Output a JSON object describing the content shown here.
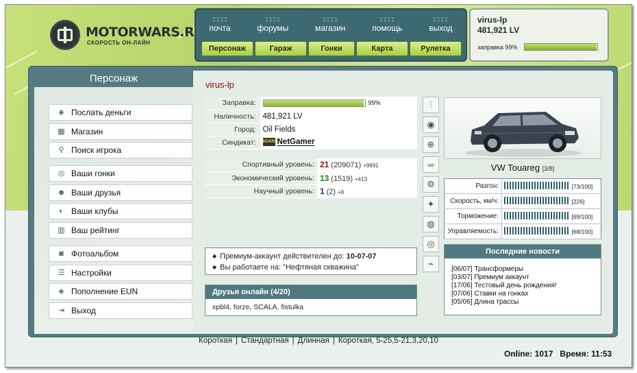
{
  "logo": {
    "title": "MOTORWARS.RU",
    "subtitle": "СКОРОСТЬ ОН-ЛАЙН"
  },
  "topnav": {
    "links": [
      "почта",
      "форумы",
      "магазин",
      "помощь",
      "выход"
    ],
    "buttons": [
      "Персонаж",
      "Гараж",
      "Гонки",
      "Карта",
      "Рулетка"
    ]
  },
  "userpanel": {
    "username": "virus-lp",
    "money": "481,921 LV",
    "fuel_label": "заправка 99%",
    "fuel_percent": 99
  },
  "sidebar": {
    "title": "Персонаж",
    "groups": [
      [
        {
          "label": "Послать деньги",
          "icon": "money-icon"
        },
        {
          "label": "Магазин",
          "icon": "shop-icon"
        },
        {
          "label": "Поиск игрока",
          "icon": "search-icon"
        }
      ],
      [
        {
          "label": "Ваши гонки",
          "icon": "steering-wheel-icon"
        },
        {
          "label": "Ваши друзья",
          "icon": "friends-icon"
        },
        {
          "label": "Ваши клубы",
          "icon": "clubs-icon"
        },
        {
          "label": "Ваш рейтинг",
          "icon": "rating-icon"
        }
      ],
      [
        {
          "label": "Фотоальбом",
          "icon": "camera-icon"
        },
        {
          "label": "Настройки",
          "icon": "settings-icon"
        },
        {
          "label": "Пополнение EUN",
          "icon": "wallet-icon"
        },
        {
          "label": "Выход",
          "icon": "exit-icon"
        }
      ]
    ]
  },
  "profile": {
    "name": "virus-lp",
    "fuel": {
      "label": "Заправка:",
      "percent": 99,
      "percent_text": "99%"
    },
    "cash": {
      "label": "Наличность:",
      "value": "481,921 LV"
    },
    "city": {
      "label": "Город:",
      "value": "Oil Fields"
    },
    "syndicate": {
      "label": "Синдикат:",
      "logo": "IGAN",
      "value": "NetGamer"
    }
  },
  "levels": [
    {
      "label": "Спортивный уровень:",
      "level": "21",
      "points": "(209071)",
      "increment": "+9691",
      "color": "#a01010"
    },
    {
      "label": "Экономический уровень:",
      "level": "13",
      "points": "(1519)",
      "increment": "+413",
      "color": "#1e7a1e"
    },
    {
      "label": "Научный уровень:",
      "level": "1",
      "points": "(2)",
      "increment": "+8",
      "color": "#1c2f74"
    }
  ],
  "premium": [
    "Премиум-аккаунт действителен до: ",
    "10-07-07",
    "Вы работаете на: \"Нефтяная скважина\""
  ],
  "friends": {
    "title": "Друзья онлайн (4/20)",
    "list": "xpbl4, forze, SCALA, fistulka"
  },
  "parts_icons": [
    "shock-absorber-icon",
    "tire-icon",
    "brakes-icon",
    "exhaust-icon",
    "gearbox-icon",
    "engine-parts-icon",
    "turbo-icon",
    "steering-icon",
    "tuning-icon"
  ],
  "car": {
    "name": "VW Touareg",
    "stage": "[3/8]",
    "stats": [
      {
        "label": "Разгон:",
        "value": "[73/100]"
      },
      {
        "label": "Скорость, км/ч:",
        "value": "[226]"
      },
      {
        "label": "Торможение:",
        "value": "[69/100]"
      },
      {
        "label": "Управляемость:",
        "value": "[68/100]"
      }
    ]
  },
  "news": {
    "title": "Последние новости",
    "items": [
      "[06/07] Трансформеры",
      "[03/07] Премиум аккаунт",
      "[17/06] Тестовый день рождения!",
      "[07/06] Ставки на гонках",
      "[05/06] Длина трассы"
    ]
  },
  "footer": {
    "links": [
      "Короткая",
      "Стандартная",
      "Длинная",
      "Короткая, 5-25,5-21,3,20,10"
    ],
    "online_label": "Online:",
    "online_value": "1017",
    "time_label": "Время:",
    "time_value": "11:53"
  }
}
